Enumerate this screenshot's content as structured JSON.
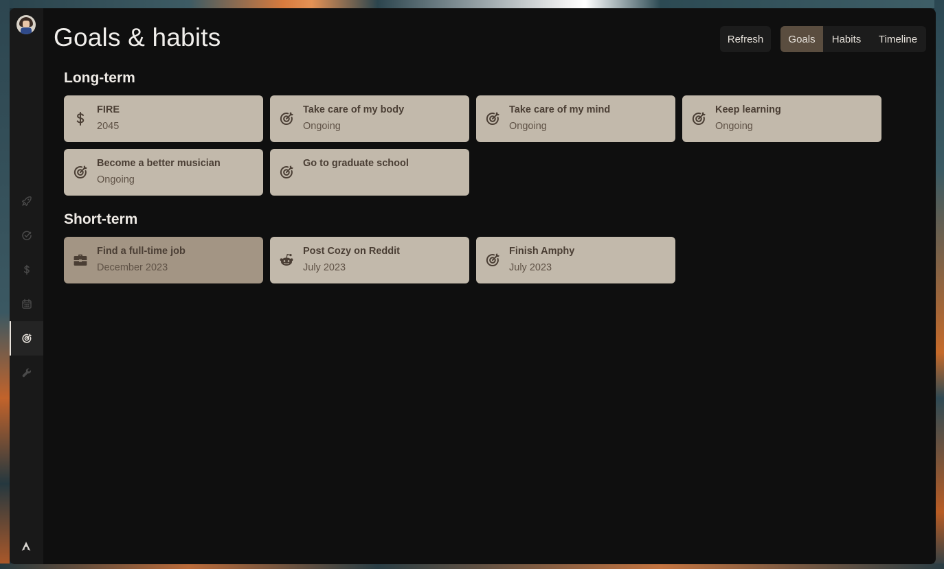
{
  "header": {
    "title": "Goals & habits",
    "refresh_label": "Refresh",
    "tabs": [
      {
        "label": "Goals",
        "active": true
      },
      {
        "label": "Habits",
        "active": false
      },
      {
        "label": "Timeline",
        "active": false
      }
    ]
  },
  "sidebar": {
    "items": [
      {
        "icon": "rocket-icon"
      },
      {
        "icon": "check-circle-icon"
      },
      {
        "icon": "dollar-icon"
      },
      {
        "icon": "calendar-icon"
      },
      {
        "icon": "target-icon",
        "active": true
      },
      {
        "icon": "wrench-icon"
      }
    ],
    "footer_icon": "arch-logo-icon"
  },
  "long_term": {
    "heading": "Long-term",
    "cards": [
      {
        "title": "FIRE",
        "subtitle": "2045",
        "icon": "dollar-icon"
      },
      {
        "title": "Take care of my body",
        "subtitle": "Ongoing",
        "icon": "target-icon"
      },
      {
        "title": "Take care of my mind",
        "subtitle": "Ongoing",
        "icon": "target-icon"
      },
      {
        "title": "Keep learning",
        "subtitle": "Ongoing",
        "icon": "target-icon"
      },
      {
        "title": "Become a better musician",
        "subtitle": "Ongoing",
        "icon": "target-icon"
      },
      {
        "title": "Go to graduate school",
        "subtitle": "",
        "icon": "target-icon"
      }
    ]
  },
  "short_term": {
    "heading": "Short-term",
    "cards": [
      {
        "title": "Find a full-time job",
        "subtitle": "December 2023",
        "icon": "briefcase-icon"
      },
      {
        "title": "Post Cozy on Reddit",
        "subtitle": "July 2023",
        "icon": "reddit-icon"
      },
      {
        "title": "Finish Amphy",
        "subtitle": "July 2023",
        "icon": "target-icon"
      }
    ]
  },
  "colors": {
    "card": "#c2b9ab",
    "card_highlight": "#a39584",
    "active_tab": "#5a4d3f",
    "background": "#0f0f0f"
  }
}
